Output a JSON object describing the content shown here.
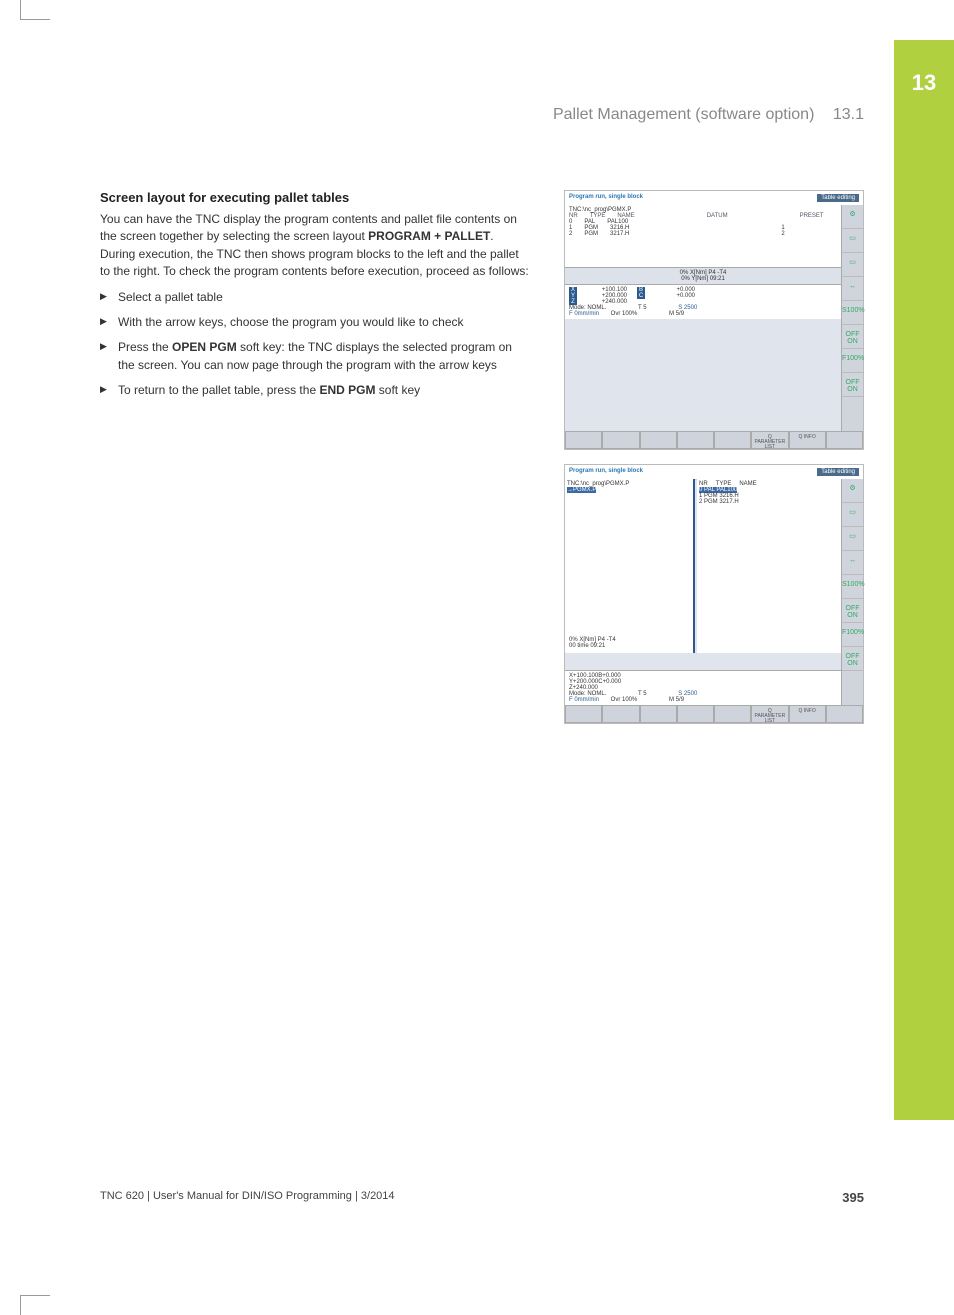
{
  "chapter_tab": "13",
  "header": {
    "title": "Pallet Management (software option)",
    "section_num": "13.1"
  },
  "heading": "Screen layout for executing pallet tables",
  "intro": {
    "p1a": "You can have the TNC display the program contents and pallet file contents on the screen together by selecting the screen layout ",
    "p1b": "PROGRAM + PALLET",
    "p1c": ". During execution, the TNC then shows program blocks to the left and the pallet to the right. To check the program contents before execution, proceed as follows:"
  },
  "steps": {
    "s1": "Select a pallet table",
    "s2": "With the arrow keys, choose the program you would like to check",
    "s3a": "Press the ",
    "s3b": "OPEN PGM",
    "s3c": " soft key: the TNC displays the selected program on the screen. You can now page through the program with the arrow keys",
    "s4a": "To return to the pallet table, press the ",
    "s4b": "END PGM",
    "s4c": " soft key"
  },
  "fig_common": {
    "title_left": "Program run, single block",
    "title_sub": "Program run single block",
    "title_right": "Table editing",
    "path": "TNC:\\nc_prog\\PGMX.P",
    "cols": {
      "nr": "NR",
      "type": "TYPE",
      "name": "NAME",
      "datum": "DATUM",
      "preset": "PRESET"
    },
    "rows": [
      {
        "nr": "0",
        "type": "PAL",
        "name": "PAL100"
      },
      {
        "nr": "1",
        "type": "PGM",
        "name": "3216.H",
        "preset": "1"
      },
      {
        "nr": "2",
        "type": "PGM",
        "name": "3217.H",
        "preset": "2"
      }
    ],
    "status1": "0% X[Nm] P4  -T4",
    "status2": "0% Y[Nm] 09:21",
    "coords": {
      "x": {
        "label": "X",
        "val": "+100.100",
        "b": "B",
        "bval": "+0.000"
      },
      "y": {
        "label": "Y",
        "val": "+200.000",
        "c": "C",
        "cval": "+0.000"
      },
      "z": {
        "label": "Z",
        "val": "+240.000"
      }
    },
    "modeline": {
      "mode": "Mode: NOML.",
      "ovr": "Ovr 100%",
      "t": "T 5",
      "s": "S 2500",
      "m": "M 5/9"
    },
    "softkeys": [
      "",
      "",
      "",
      "",
      "",
      "Q PARAMETER LIST",
      "Q INFO",
      ""
    ],
    "side_labels": [
      "S100%",
      "OFF  ON",
      "F100%",
      "OFF  ON"
    ]
  },
  "fig2_extra": {
    "left_line": "→PGMX.P",
    "status_left": "0% X[Nm] P4  -T4",
    "status_left2": "00 time 09:21"
  },
  "footer": {
    "left": "TNC 620 | User's Manual for DIN/ISO Programming | 3/2014",
    "page": "395"
  }
}
